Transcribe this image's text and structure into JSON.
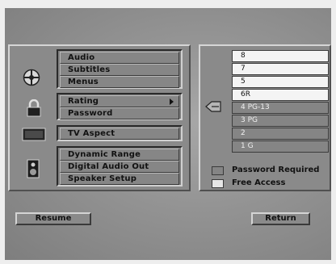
{
  "menu": {
    "audio_group": [
      "Audio",
      "Subtitles",
      "Menus"
    ],
    "rating_group": [
      "Rating",
      "Password"
    ],
    "aspect_group": [
      "TV Aspect"
    ],
    "sound_group": [
      "Dynamic Range",
      "Digital Audio Out",
      "Speaker Setup"
    ]
  },
  "ratings": {
    "levels": [
      {
        "label": "8",
        "state": "allowed"
      },
      {
        "label": "7",
        "state": "allowed"
      },
      {
        "label": "5",
        "state": "allowed"
      },
      {
        "label": "6R",
        "state": "allowed"
      },
      {
        "label": "4 PG-13",
        "state": "blocked"
      },
      {
        "label": "3 PG",
        "state": "blocked"
      },
      {
        "label": "2",
        "state": "blocked"
      },
      {
        "label": "1 G",
        "state": "blocked"
      }
    ],
    "legend": {
      "password_required": "Password Required",
      "free_access": "Free Access"
    },
    "colors": {
      "allowed": "#f4f4f4",
      "blocked": "#858585"
    }
  },
  "actions": {
    "resume": "Resume",
    "return": "Return"
  },
  "icons": {
    "audio_group": "disc-icon",
    "rating_group": "padlock-icon",
    "aspect_group": "tv-icon",
    "sound_group": "speaker-icon",
    "rating_pointer": "pointer-icon"
  }
}
